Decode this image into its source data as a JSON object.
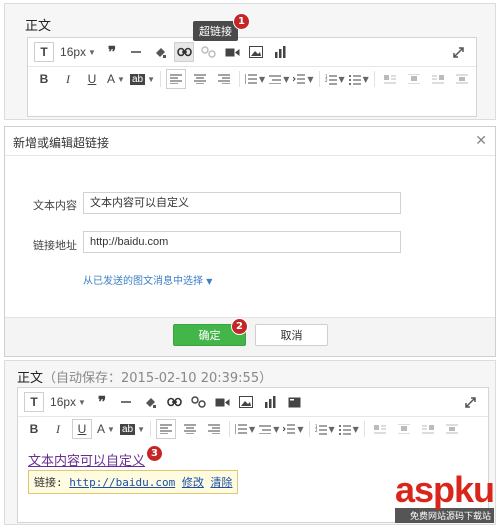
{
  "panel1": {
    "title": "正文",
    "tooltip": "超链接",
    "badge": "1",
    "font_size": "16px"
  },
  "dialog": {
    "title": "新增或编辑超链接",
    "label_text": "文本内容",
    "text_value": "文本内容可以自定义",
    "label_url": "链接地址",
    "url_value": "http://baidu.com",
    "select_link": "从已发送的图文消息中选择",
    "ok_label": "确定",
    "cancel_label": "取消",
    "badge": "2"
  },
  "panel3": {
    "title": "正文",
    "autosave": "（自动保存：2015-02-10 20:39:55）",
    "font_size": "16px",
    "content_link_text": "文本内容可以自定义",
    "badge": "3",
    "popup_label": "链接:",
    "popup_url": "http://baidu.com",
    "popup_edit": "修改",
    "popup_clear": "清除"
  },
  "watermark": {
    "brand": "aspku",
    "tagline": "免费网站源码下载站"
  }
}
